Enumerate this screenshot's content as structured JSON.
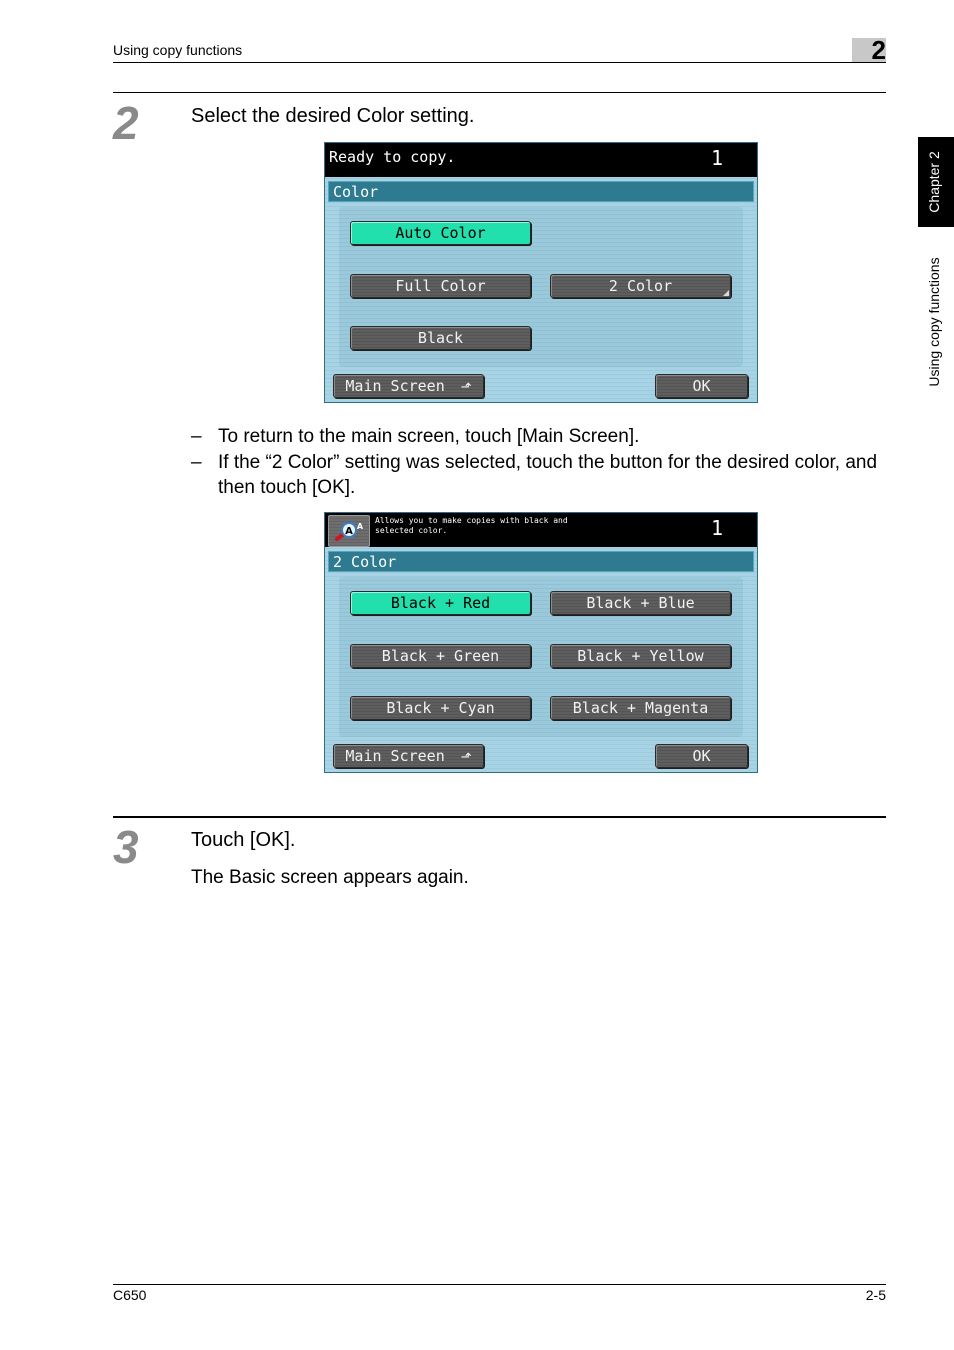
{
  "header": {
    "section_title": "Using copy functions",
    "chapter_number": "2"
  },
  "side_tab": {
    "chapter_label": "Chapter 2",
    "section_label": "Using copy functions"
  },
  "steps": [
    {
      "number": "2",
      "instruction": "Select the desired Color setting.",
      "bullets": [
        "To return to the main screen, touch [Main Screen].",
        "If the “2 Color” setting was selected, touch the button for the desired color, and then touch [OK]."
      ]
    },
    {
      "number": "3",
      "instruction": "Touch [OK].",
      "result": "The Basic screen appears again."
    }
  ],
  "screen_color": {
    "status_text": "Ready to copy.",
    "copy_count": "1",
    "section_title": "Color",
    "buttons": [
      {
        "label": "Auto Color",
        "selected": true
      },
      {
        "label": "Full Color",
        "selected": false
      },
      {
        "label": "2 Color",
        "selected": false,
        "has_submenu": true
      },
      {
        "label": "Black",
        "selected": false
      }
    ],
    "main_screen_label": "Main Screen",
    "ok_label": "OK"
  },
  "screen_two_color": {
    "help_icon": "help-magnifier-icon",
    "message_line1": "Allows you to make copies with black and",
    "message_line2": "selected color.",
    "copy_count": "1",
    "section_title": "2 Color",
    "buttons": [
      {
        "label": "Black + Red",
        "selected": true
      },
      {
        "label": "Black + Blue",
        "selected": false
      },
      {
        "label": "Black + Green",
        "selected": false
      },
      {
        "label": "Black + Yellow",
        "selected": false
      },
      {
        "label": "Black + Cyan",
        "selected": false
      },
      {
        "label": "Black + Magenta",
        "selected": false
      }
    ],
    "main_screen_label": "Main Screen",
    "ok_label": "OK"
  },
  "footer": {
    "model": "C650",
    "page_number": "2-5"
  },
  "icons": {
    "main_screen_arrow": "⬏"
  },
  "colors": {
    "selected_button": "#22e0ad",
    "title_bar": "#2e7a90",
    "panel_bg": "#a7d3e4",
    "step_number": "#8a8a8a"
  }
}
